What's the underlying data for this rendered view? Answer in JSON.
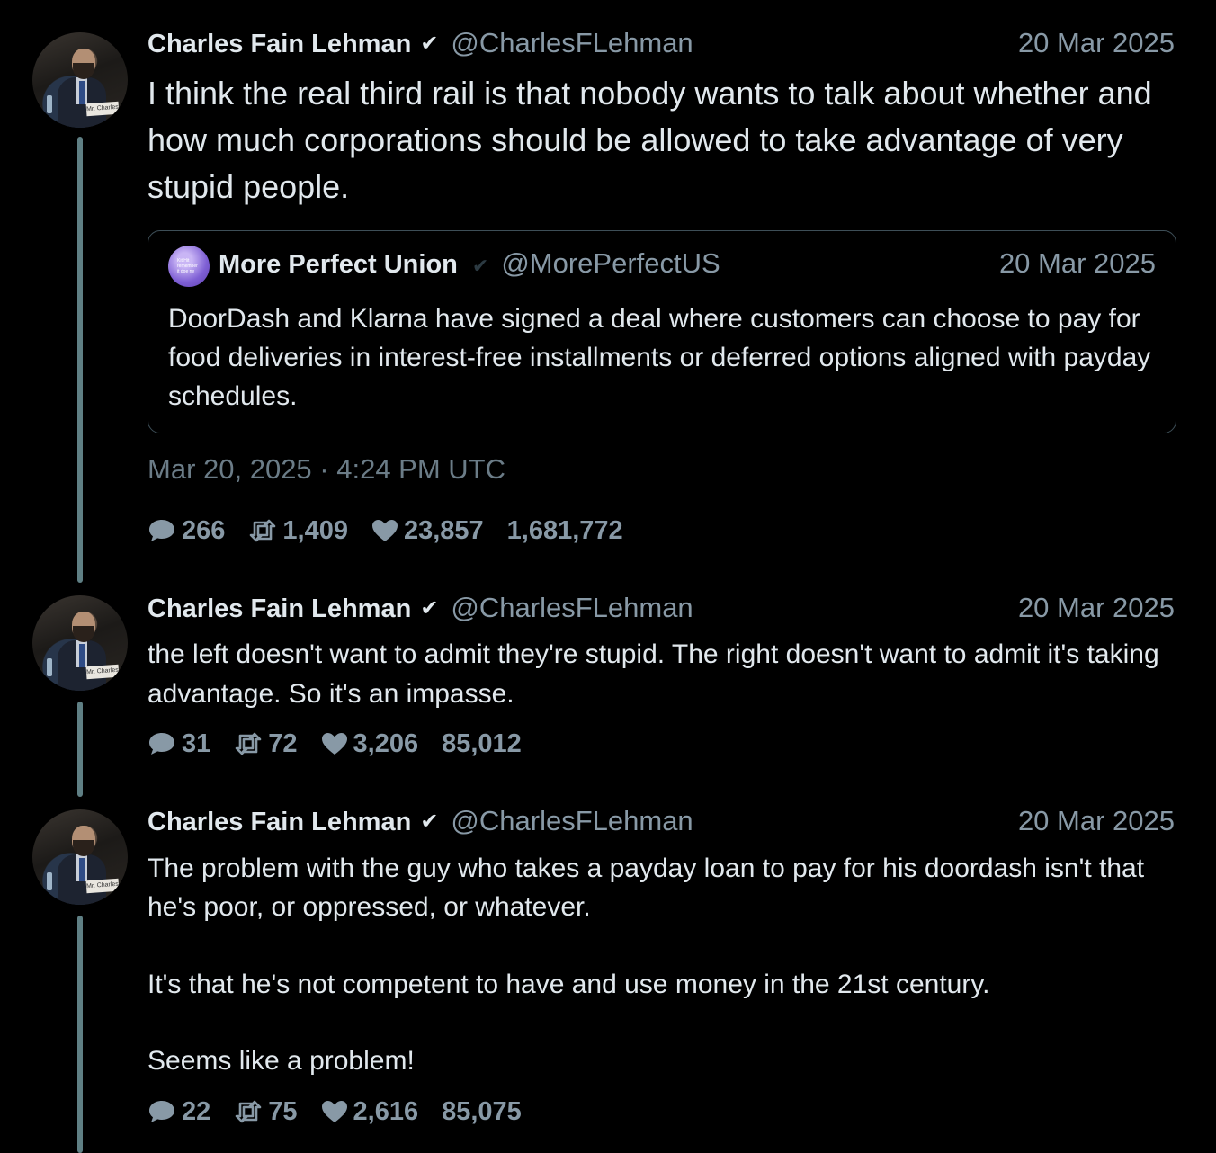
{
  "tweets": [
    {
      "author": "Charles Fain Lehman",
      "verified_icon": "✔",
      "handle": "@CharlesFLehman",
      "date": "20 Mar 2025",
      "text": "I think the real third rail is that nobody wants to talk about whether and how much corporations should be allowed to take advantage of very stupid people.",
      "quote": {
        "author": "More Perfect Union",
        "handle": "@MorePerfectUS",
        "date": "20 Mar 2025",
        "text": "DoorDash and Klarna have signed a deal where customers can choose to pay for food deliveries in  interest-free installments or deferred options aligned with payday schedules.",
        "avatar_text": "Kit Hit remember it doe ne"
      },
      "timestamp": "Mar 20, 2025 · 4:24 PM UTC",
      "stats": {
        "replies": "266",
        "retweets": "1,409",
        "likes": "23,857",
        "views": "1,681,772"
      }
    },
    {
      "author": "Charles Fain Lehman",
      "verified_icon": "✔",
      "handle": "@CharlesFLehman",
      "date": "20 Mar 2025",
      "text": "the left doesn't want to admit they're stupid. The right doesn't want to admit it's taking advantage. So it's an impasse.",
      "stats": {
        "replies": "31",
        "retweets": "72",
        "likes": "3,206",
        "views": "85,012"
      }
    },
    {
      "author": "Charles Fain Lehman",
      "verified_icon": "✔",
      "handle": "@CharlesFLehman",
      "date": "20 Mar 2025",
      "paragraphs": [
        "The problem with the guy who takes a payday loan to pay for his doordash isn't that he's poor, or oppressed, or whatever.",
        "It's that he's not competent to have and use money in the 21st century.",
        "Seems like a problem!"
      ],
      "stats": {
        "replies": "22",
        "retweets": "75",
        "likes": "2,616",
        "views": "85,075"
      }
    }
  ],
  "avatar_placard": "Mr. Charles",
  "colors": {
    "background": "#000000",
    "text": "#e1e8ed",
    "muted": "#8899a6",
    "thread_line": "#5f7f84",
    "quote_border": "#3d4e57"
  },
  "icons": {
    "reply": "speech-bubble-icon",
    "retweet": "retweet-icon",
    "like": "heart-icon",
    "verified": "checkmark-icon"
  }
}
